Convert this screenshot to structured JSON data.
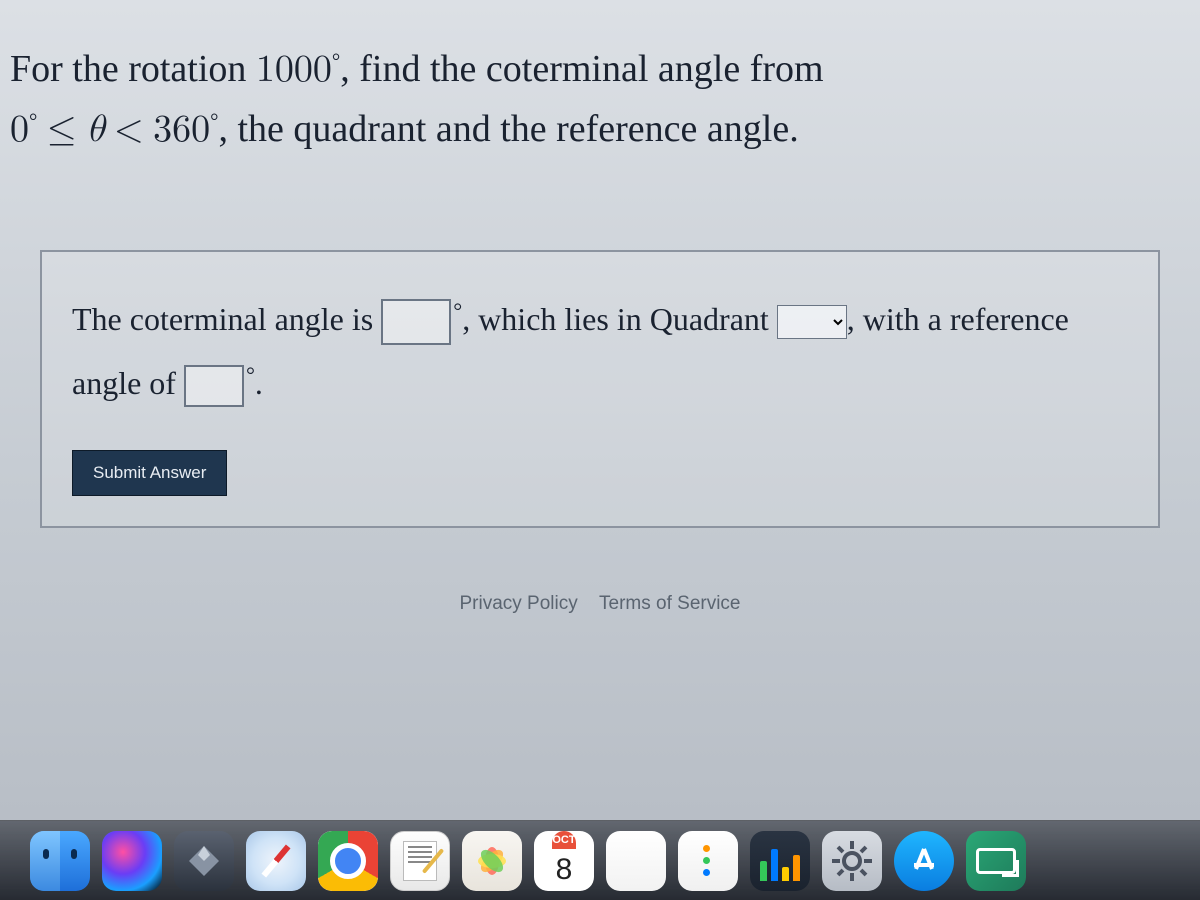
{
  "question": {
    "part1": "For the rotation ",
    "rotation": "1000",
    "part2": ", find the coterminal angle from ",
    "range_low": "0",
    "range_rel1": "≤",
    "theta": "θ",
    "range_rel2": "<",
    "range_high": "360",
    "part3": ", the quadrant and the reference angle."
  },
  "answer": {
    "seg1": "The coterminal angle is ",
    "seg2": ", which lies in Quadrant ",
    "seg3": ", with a reference angle of ",
    "seg4": ".",
    "coterminal_value": "",
    "quadrant_value": "",
    "reference_value": ""
  },
  "buttons": {
    "submit": "Submit Answer"
  },
  "footer": {
    "privacy": "Privacy Policy",
    "terms": "Terms of Service"
  },
  "dock": {
    "calendar_month": "OCT",
    "calendar_day": "8"
  }
}
